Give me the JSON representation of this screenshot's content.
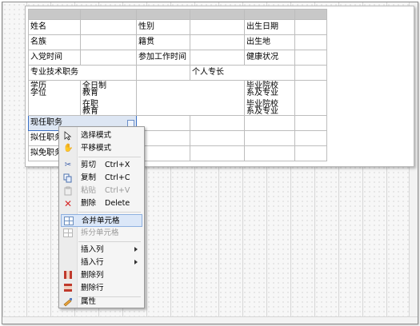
{
  "table": {
    "rows": [
      [
        "姓名",
        "",
        "性别",
        "",
        "出生日期",
        ""
      ],
      [
        "名族",
        "",
        "籍贯",
        "",
        "出生地",
        ""
      ],
      [
        "入党时间",
        "",
        "参加工作时间",
        "",
        "健康状况",
        ""
      ],
      [
        "专业技术职务",
        "",
        "",
        "个人专长",
        "",
        ""
      ],
      [
        "学历",
        "全日制",
        "毕业院校",
        "学位",
        "在职",
        "毕业院校"
      ],
      [
        "现任职务",
        "",
        "",
        "",
        "",
        ""
      ],
      [
        "拟任职务",
        "",
        "",
        "",
        "",
        ""
      ],
      [
        "拟免职务",
        "",
        "",
        "",
        "",
        ""
      ]
    ],
    "clipped": {
      "fulltime_edu": "教育",
      "fulltime_major": "系及专业",
      "parttime_edu": "教育",
      "parttime_major": "系及专业"
    }
  },
  "context_menu": {
    "items": [
      {
        "icon": "pointer-icon",
        "label": "选择模式",
        "shortcut": ""
      },
      {
        "icon": "hand-icon",
        "label": "平移模式",
        "shortcut": ""
      },
      {
        "icon": "scissors-icon",
        "label": "剪切",
        "shortcut": "Ctrl+X"
      },
      {
        "icon": "copy-icon",
        "label": "复制",
        "shortcut": "Ctrl+C"
      },
      {
        "icon": "paste-icon",
        "label": "粘贴",
        "shortcut": "Ctrl+V",
        "disabled": true
      },
      {
        "icon": "delete-icon",
        "label": "删除",
        "shortcut": "Delete"
      },
      {
        "icon": "merge-cells-icon",
        "label": "合并单元格",
        "highlighted": true
      },
      {
        "icon": "split-cells-icon",
        "label": "拆分单元格",
        "disabled": true
      },
      {
        "label": "插入列",
        "submenu": true
      },
      {
        "label": "插入行",
        "submenu": true
      },
      {
        "icon": "delete-column-icon",
        "label": "删除列"
      },
      {
        "icon": "delete-row-icon",
        "label": "删除行"
      },
      {
        "icon": "properties-icon",
        "label": "属性"
      }
    ]
  },
  "colors": {
    "highlight": "#dbe7f8",
    "selection_border": "#3b6fc4",
    "delete_icon": "#d62b2b"
  }
}
